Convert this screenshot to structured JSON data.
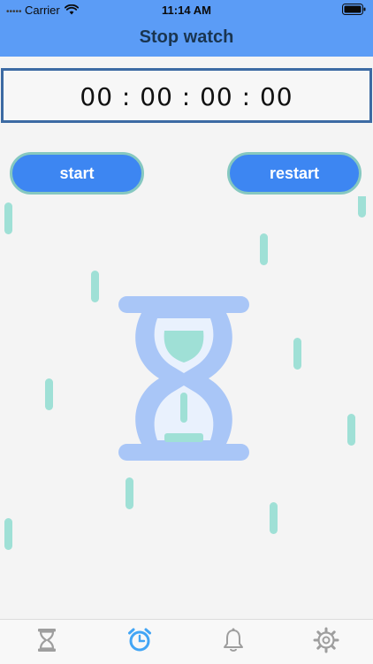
{
  "status_bar": {
    "carrier": "Carrier",
    "time": "11:14 AM"
  },
  "nav": {
    "title": "Stop watch"
  },
  "stopwatch": {
    "display": "00 : 00 : 00 : 00"
  },
  "buttons": {
    "start_label": "start",
    "restart_label": "restart"
  },
  "tabs": [
    {
      "icon": "hourglass-icon",
      "selected": false
    },
    {
      "icon": "alarm-clock-icon",
      "selected": true
    },
    {
      "icon": "bell-icon",
      "selected": false
    },
    {
      "icon": "gear-icon",
      "selected": false
    }
  ],
  "colors": {
    "nav_bar": "#5b9cf6",
    "button": "#3d86f2",
    "button_border": "#86c8c0",
    "accent_teal": "#9fe0d6",
    "hourglass": "#a9c6f7",
    "tab_selected": "#42a5f5",
    "tab_unselected": "#9e9e9e"
  }
}
